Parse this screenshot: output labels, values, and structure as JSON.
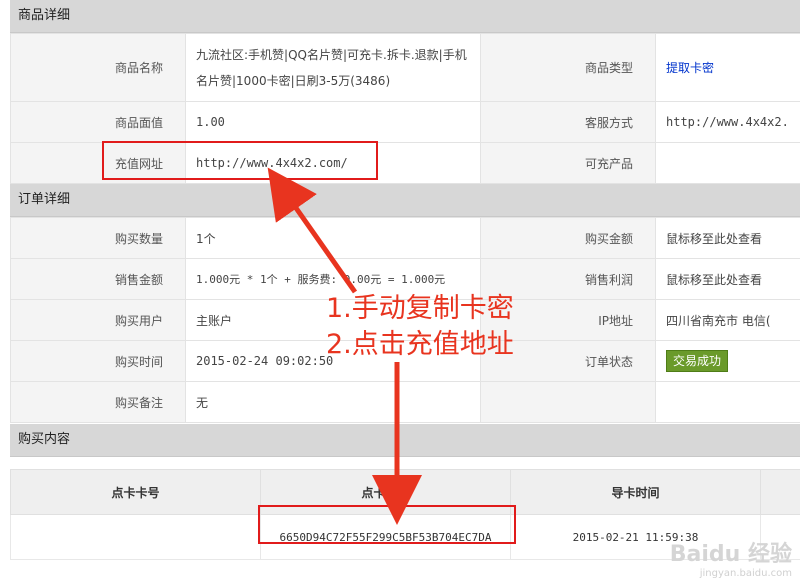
{
  "goods_section": {
    "title": "商品详细",
    "name_label": "商品名称",
    "name_value": "九流社区:手机赞|QQ名片赞|可充卡.拆卡.退款|手机名片赞|1000卡密|日刷3-5万(3486)",
    "type_label": "商品类型",
    "type_value": "提取卡密",
    "face_label": "商品面值",
    "face_value": "1.00",
    "service_label": "客服方式",
    "service_value": "http://www.4x4x2.",
    "recharge_label": "充值网址",
    "recharge_value": "http://www.4x4x2.com/",
    "product_label": "可充产品",
    "product_value": ""
  },
  "order_section": {
    "title": "订单详细",
    "qty_label": "购买数量",
    "qty_value": "1个",
    "amount_label": "购买金额",
    "amount_value": "鼠标移至此处查看",
    "sale_label": "销售金额",
    "sale_value": "1.000元 * 1个 + 服务费: 0.00元 = 1.000元",
    "profit_label": "销售利润",
    "profit_value": "鼠标移至此处查看",
    "user_label": "购买用户",
    "user_value": "主账户",
    "ip_label": "IP地址",
    "ip_value": "四川省南充市 电信(",
    "time_label": "购买时间",
    "time_value": "2015-02-24 09:02:50",
    "status_label": "订单状态",
    "status_value": "交易成功",
    "note_label": "购买备注",
    "note_value": "无"
  },
  "content_section": {
    "title": "购买内容",
    "columns": [
      "点卡卡号",
      "点卡密码",
      "导卡时间"
    ],
    "rows": [
      {
        "card_no": "",
        "card_pwd": "6650D94C72F55F299C5BF53B704EC7DA",
        "import_time": "2015-02-21 11:59:38"
      }
    ]
  },
  "annotation": {
    "line1": "1.手动复制卡密",
    "line2": "2.点击充值地址",
    "color": "#e8341f"
  },
  "watermark": {
    "logo": "Baidu 经验",
    "url": "jingyan.baidu.com"
  }
}
